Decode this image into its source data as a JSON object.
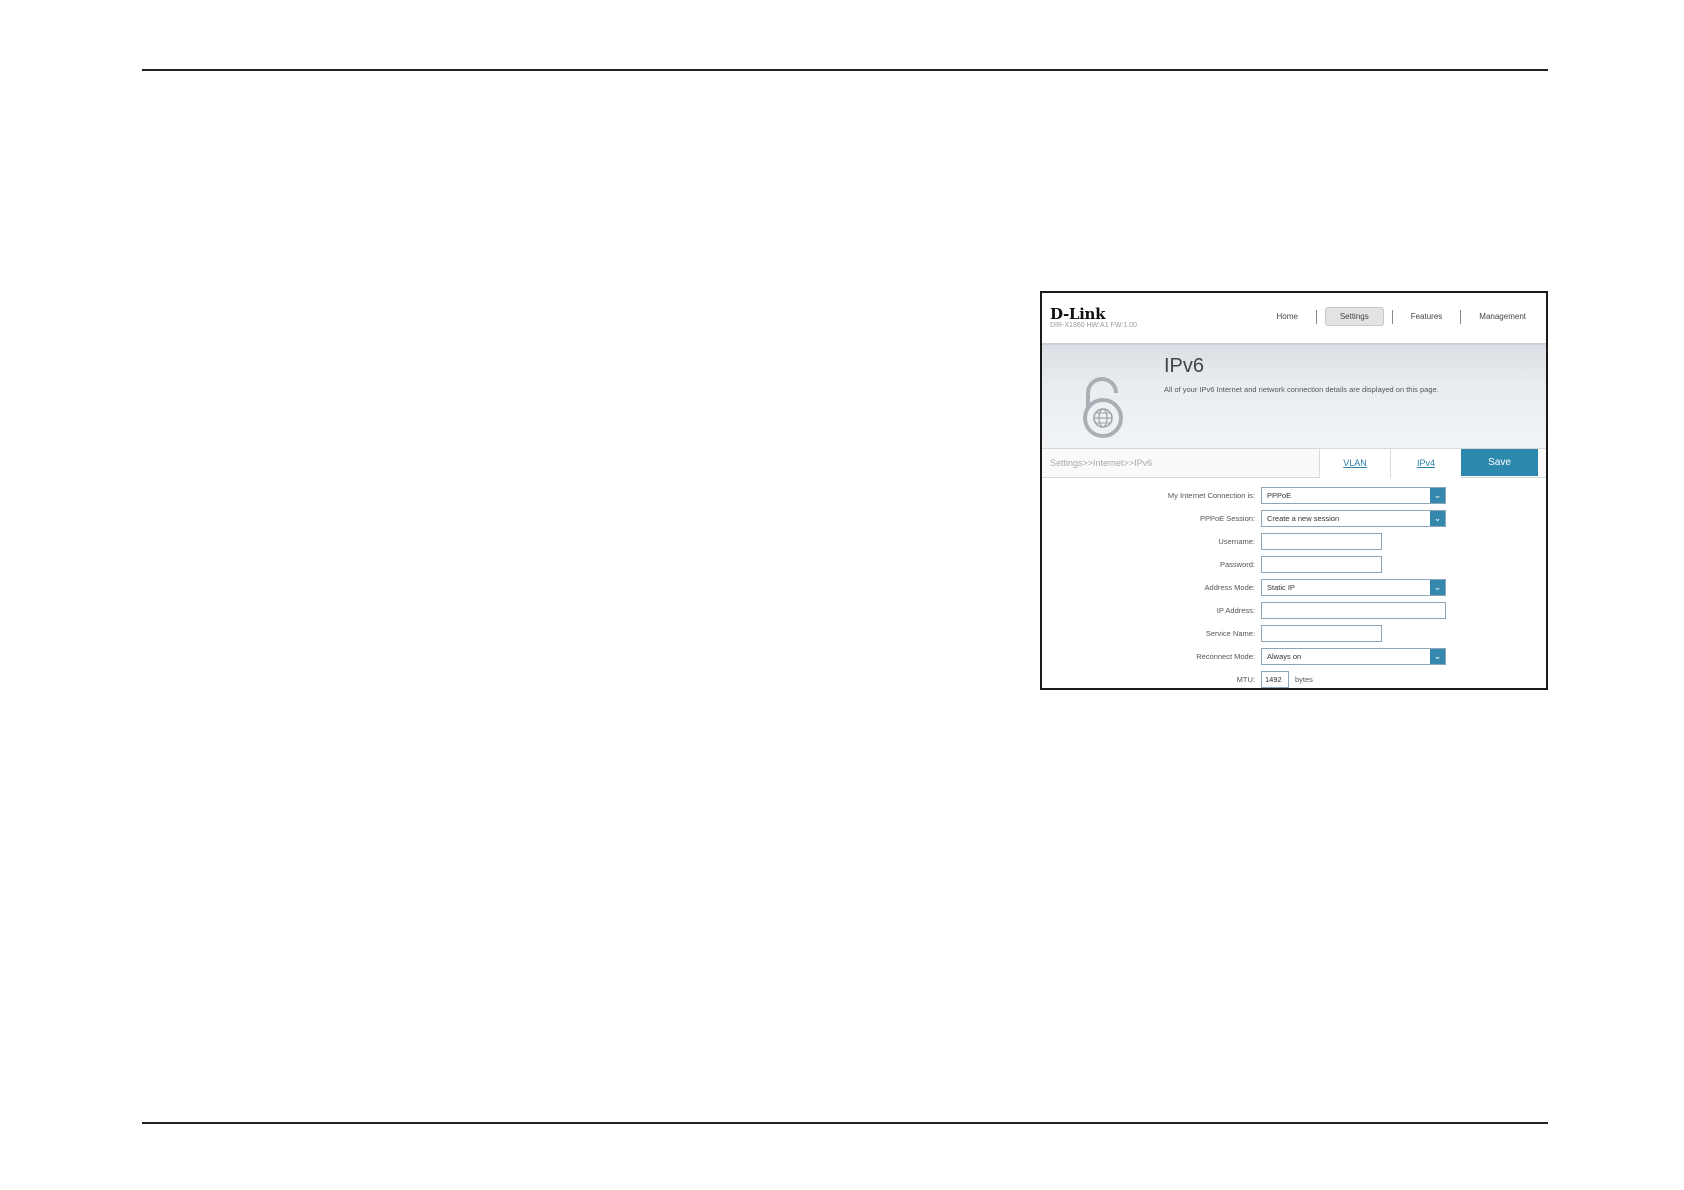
{
  "brand": {
    "logo": "D-Link",
    "model": "DIR-X1860 HW:A1 FW:1.00"
  },
  "nav": {
    "items": [
      "Home",
      "Settings",
      "Features",
      "Management"
    ],
    "active": "Settings"
  },
  "banner": {
    "title": "IPv6",
    "description": "All of your IPv6 Internet and network connection details are displayed on this page."
  },
  "breadcrumb": "Settings>>Internet>>IPv6",
  "actions": {
    "vlan": "VLAN",
    "ipv4": "IPv4",
    "save": "Save"
  },
  "form": {
    "connection": {
      "label": "My Internet Connection is:",
      "value": "PPPoE"
    },
    "session": {
      "label": "PPPoE Session:",
      "value": "Create a new session"
    },
    "username": {
      "label": "Username:",
      "value": ""
    },
    "password": {
      "label": "Password:",
      "value": ""
    },
    "address_mode": {
      "label": "Address Mode:",
      "value": "Static IP"
    },
    "ip_address": {
      "label": "IP Address:",
      "value": ""
    },
    "service_name": {
      "label": "Service Name:",
      "value": ""
    },
    "reconnect_mode": {
      "label": "Reconnect Mode:",
      "value": "Always on"
    },
    "mtu": {
      "label": "MTU:",
      "value": "1492",
      "unit": "bytes"
    }
  },
  "colors": {
    "accent": "#2d88ad",
    "link": "#2b7fa8"
  },
  "icons": {
    "banner": "lock-globe-icon",
    "dropdown": "chevron-down-icon"
  }
}
